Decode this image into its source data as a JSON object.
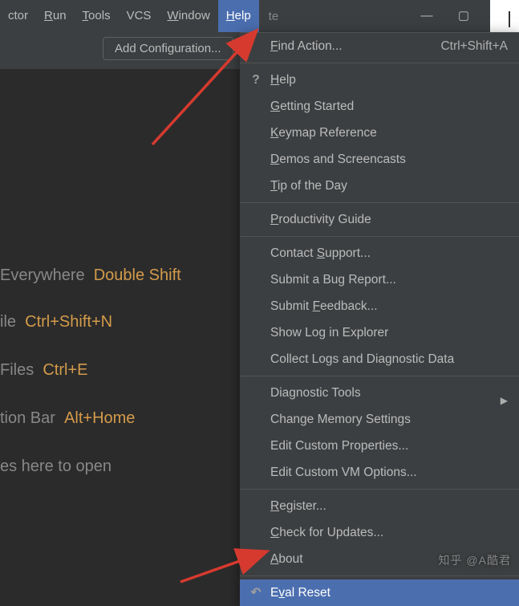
{
  "menubar": {
    "items": [
      {
        "pre": "ctor"
      },
      {
        "u": "R",
        "rest": "un"
      },
      {
        "u": "T",
        "rest": "ools"
      },
      {
        "plain": "VCS"
      },
      {
        "u": "W",
        "rest": "indow"
      },
      {
        "u": "H",
        "rest": "elp",
        "active": true
      }
    ],
    "project": "te",
    "window_buttons": {
      "min": "—",
      "max": "▢",
      "close": "✕"
    }
  },
  "toolbar": {
    "add_config": "Add Configuration..."
  },
  "tips": {
    "t1_pre": "Everywhere",
    "t1_key": "Double Shift",
    "t2_pre": "ile",
    "t2_key": "Ctrl+Shift+N",
    "t3_pre": "Files",
    "t3_key": "Ctrl+E",
    "t4_pre": "tion Bar",
    "t4_key": "Alt+Home",
    "t5_pre": "es here to open"
  },
  "help_menu": {
    "items": [
      {
        "label_u": "F",
        "label_rest": "ind Action...",
        "shortcut": "Ctrl+Shift+A"
      },
      {
        "sep": true
      },
      {
        "icon": "?",
        "label_u": "H",
        "label_rest": "elp"
      },
      {
        "label_u": "G",
        "label_rest": "etting Started"
      },
      {
        "label_u": "K",
        "label_rest": "eymap Reference"
      },
      {
        "label_u": "D",
        "label_rest": "emos and Screencasts"
      },
      {
        "label_u": "T",
        "label_rest": "ip of the Day"
      },
      {
        "sep": true
      },
      {
        "label_u": "P",
        "label_rest": "roductivity Guide"
      },
      {
        "sep": true
      },
      {
        "pre": "Contact ",
        "label_u": "S",
        "label_rest": "upport..."
      },
      {
        "plain": "Submit a Bug Report..."
      },
      {
        "pre": "Submit ",
        "label_u": "F",
        "label_rest": "eedback..."
      },
      {
        "plain": "Show Log in Explorer"
      },
      {
        "plain": "Collect Logs and Diagnostic Data"
      },
      {
        "sep": true
      },
      {
        "plain": "Diagnostic Tools",
        "submenu": true
      },
      {
        "plain": "Change Memory Settings"
      },
      {
        "plain": "Edit Custom Properties..."
      },
      {
        "plain": "Edit Custom VM Options..."
      },
      {
        "sep": true
      },
      {
        "label_u": "R",
        "label_rest": "egister..."
      },
      {
        "label_u": "C",
        "label_rest": "heck for Updates..."
      },
      {
        "label_u": "A",
        "label_rest": "bout"
      },
      {
        "sep": true
      },
      {
        "icon": "↶",
        "pre": "E",
        "label_u": "v",
        "label_rest": "al Reset",
        "selected": true
      }
    ]
  },
  "watermark": "知乎 @A酷君"
}
